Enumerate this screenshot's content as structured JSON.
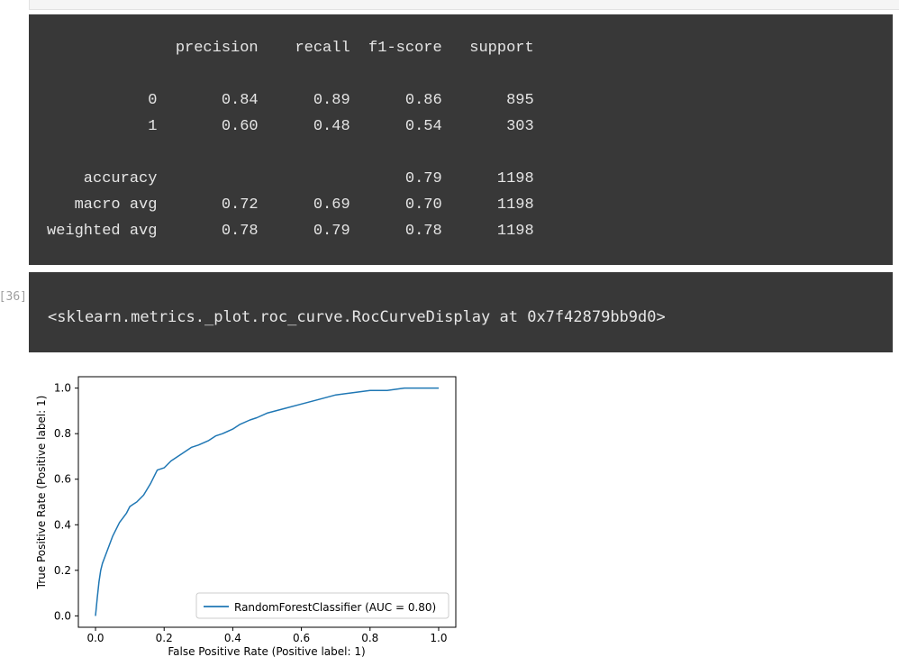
{
  "cell_prompt": "In [36]:",
  "classification_report": {
    "header": "              precision    recall  f1-score   support",
    "rows": [
      "",
      "           0       0.84      0.89      0.86       895",
      "           1       0.60      0.48      0.54       303",
      "",
      "    accuracy                           0.79      1198",
      "   macro avg       0.72      0.69      0.70      1198",
      "weighted avg       0.78      0.79      0.78      1198"
    ]
  },
  "repr_output": "<sklearn.metrics._plot.roc_curve.RocCurveDisplay at 0x7f42879bb9d0>",
  "chart_data": {
    "type": "line",
    "xlabel": "False Positive Rate (Positive label: 1)",
    "ylabel": "True Positive Rate (Positive label: 1)",
    "xlim": [
      -0.05,
      1.05
    ],
    "ylim": [
      -0.05,
      1.05
    ],
    "xticks": [
      "0.0",
      "0.2",
      "0.4",
      "0.6",
      "0.8",
      "1.0"
    ],
    "yticks": [
      "0.0",
      "0.2",
      "0.4",
      "0.6",
      "0.8",
      "1.0"
    ],
    "grid": false,
    "legend_position": "lower-right",
    "series": [
      {
        "name": "RandomForestClassifier (AUC = 0.80)",
        "color": "#1f77b4",
        "x": [
          0.0,
          0.005,
          0.01,
          0.015,
          0.02,
          0.03,
          0.04,
          0.05,
          0.06,
          0.07,
          0.08,
          0.09,
          0.1,
          0.11,
          0.12,
          0.14,
          0.16,
          0.17,
          0.18,
          0.2,
          0.22,
          0.25,
          0.28,
          0.3,
          0.33,
          0.35,
          0.37,
          0.4,
          0.42,
          0.45,
          0.47,
          0.5,
          0.55,
          0.6,
          0.65,
          0.7,
          0.75,
          0.8,
          0.85,
          0.9,
          0.95,
          1.0
        ],
        "y": [
          0.0,
          0.08,
          0.15,
          0.2,
          0.23,
          0.27,
          0.31,
          0.35,
          0.38,
          0.41,
          0.43,
          0.45,
          0.48,
          0.49,
          0.5,
          0.53,
          0.58,
          0.61,
          0.64,
          0.65,
          0.68,
          0.71,
          0.74,
          0.75,
          0.77,
          0.79,
          0.8,
          0.82,
          0.84,
          0.86,
          0.87,
          0.89,
          0.91,
          0.93,
          0.95,
          0.97,
          0.98,
          0.99,
          0.99,
          1.0,
          1.0,
          1.0
        ]
      }
    ]
  }
}
